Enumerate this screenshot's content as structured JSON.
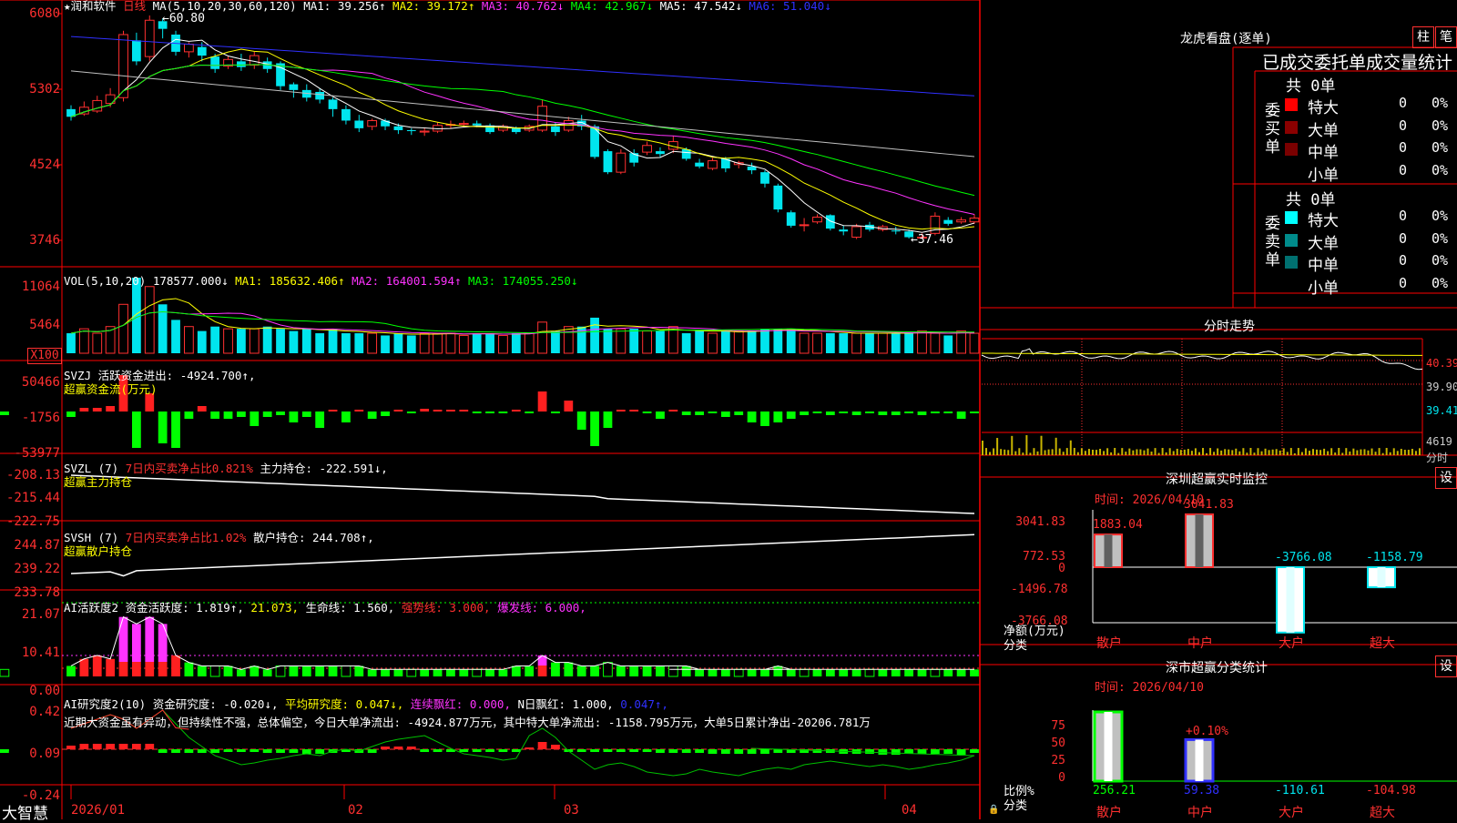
{
  "stock": {
    "star": "★",
    "name": "润和软件",
    "period": "日线"
  },
  "colors": {
    "up": "#ff3030",
    "down": "#00e5ee",
    "ma1": "#ffffff",
    "ma2": "#ffff00",
    "ma3": "#ff33ff",
    "ma4": "#00ff00",
    "ma5": "#c0c0c0",
    "ma6": "#3030ff",
    "frame": "#ff0000"
  },
  "main": {
    "ma_label": "MA(5,10,20,30,60,120)",
    "ma": [
      {
        "label": "MA1: 39.256",
        "arrow": "↑",
        "color": "#ffffff"
      },
      {
        "label": "MA2: 39.172",
        "arrow": "↑",
        "color": "#ffff00"
      },
      {
        "label": "MA3: 40.762",
        "arrow": "↓",
        "color": "#ff33ff"
      },
      {
        "label": "MA4: 42.967",
        "arrow": "↓",
        "color": "#00ff00"
      },
      {
        "label": "MA5: 47.542",
        "arrow": "↓",
        "color": "#ffffff"
      },
      {
        "label": "MA6: 51.040",
        "arrow": "↓",
        "color": "#3030ff"
      }
    ],
    "yticks": [
      "6080",
      "5302",
      "4524",
      "3746"
    ],
    "high_label": "60.80",
    "low_label": "37.46"
  },
  "vol": {
    "label": "VOL(5,10,20)",
    "items": [
      {
        "label": "178577.000",
        "arrow": "↓",
        "color": "#ffffff"
      },
      {
        "label": "MA1: 185632.406",
        "arrow": "↑",
        "color": "#ffff00"
      },
      {
        "label": "MA2: 164001.594",
        "arrow": "↑",
        "color": "#ff33ff"
      },
      {
        "label": "MA3: 174055.250",
        "arrow": "↓",
        "color": "#00ff00"
      }
    ],
    "yticks": [
      "11064",
      "5464"
    ],
    "unit": "X100"
  },
  "svzj": {
    "title": "SVZJ",
    "line1": "活跃资金进出: -4924.700↑,",
    "line2": "超赢资金流(万元)",
    "yticks": [
      "50466",
      "-1756",
      "-53977"
    ]
  },
  "svzl": {
    "title": "SVZL (7)",
    "red": "7日内买卖净占比0.821%",
    "white": "主力持仓: -222.591↓,",
    "line2": "超赢主力持仓",
    "yticks": [
      "-208.13",
      "-215.44",
      "-222.75"
    ]
  },
  "svsh": {
    "title": "SVSH (7)",
    "red": "7日内买卖净占比1.02%",
    "white": "散户持仓: 244.708↑,",
    "line2": "超赢散户持仓",
    "yticks": [
      "244.87",
      "239.22",
      "233.78"
    ]
  },
  "ai1": {
    "title": "AI活跃度2",
    "items": [
      {
        "label": "资金活跃度: 1.819↑,",
        "color": "#ffffff"
      },
      {
        "label": "21.073,",
        "color": "#ffff00"
      },
      {
        "label": "生命线: 1.560,",
        "color": "#ffffff"
      },
      {
        "label": "强势线: 3.000,",
        "color": "#ff3030"
      },
      {
        "label": "爆发线: 6.000,",
        "color": "#ff33ff"
      }
    ],
    "yticks": [
      "21.07",
      "10.41",
      "0.00"
    ]
  },
  "ai2": {
    "title": "AI研究度2(10)",
    "items": [
      {
        "label": "资金研究度: -0.020↓,",
        "color": "#ffffff"
      },
      {
        "label": "平均研究度: 0.047↓,",
        "color": "#ffff00"
      },
      {
        "label": "连续飘红: 0.000,",
        "color": "#ff33ff"
      },
      {
        "label": "N日飘红: 1.000,",
        "color": "#ffffff"
      },
      {
        "label": "0.047↑,",
        "color": "#3030ff"
      }
    ],
    "comment": "近期大资金虽有异动，但持续性不强，总体偏空，今日大单净流出: -4924.877万元，其中特大单净流出: -1158.795万元，大单5日累计净出-20206.781万",
    "yticks": [
      "0.42",
      "0.09",
      "-0.24"
    ]
  },
  "xaxis": {
    "labels": [
      "2026/01",
      "02",
      "03",
      "04"
    ],
    "brand": "大智慧"
  },
  "right": {
    "lhb": {
      "title": "龙虎看盘(逐单)",
      "btn1": "柱",
      "btn2": "笔",
      "header": "已成交委托单成交量统计",
      "buy": {
        "side_label": "委买单",
        "total": "共 0单",
        "rows": [
          {
            "name": "特大",
            "value": "0",
            "pct": "0%",
            "color": "#ff0000"
          },
          {
            "name": "大单",
            "value": "0",
            "pct": "0%",
            "color": "#8b0000"
          },
          {
            "name": "中单",
            "value": "0",
            "pct": "0%",
            "color": "#7a0000"
          },
          {
            "name": "小单",
            "value": "0",
            "pct": "0%",
            "color": ""
          }
        ]
      },
      "sell": {
        "side_label": "委卖单",
        "total": "共 0单",
        "rows": [
          {
            "name": "特大",
            "value": "0",
            "pct": "0%",
            "color": "#00ffff"
          },
          {
            "name": "大单",
            "value": "0",
            "pct": "0%",
            "color": "#008b8b"
          },
          {
            "name": "中单",
            "value": "0",
            "pct": "0%",
            "color": "#007070"
          },
          {
            "name": "小单",
            "value": "0",
            "pct": "0%",
            "color": ""
          }
        ]
      }
    },
    "fenshi": {
      "title": "分时走势",
      "prices": [
        "40.39",
        "39.90",
        "39.41"
      ],
      "vol_label": "4619",
      "vol_unit": "分时"
    },
    "monitor": {
      "title": "深圳超赢实时监控",
      "btn": "设",
      "time": "时间: 2026/04/10",
      "yticks": [
        "3041.83",
        "772.53",
        "0",
        "-1496.78",
        "-3766.08"
      ],
      "ylabel": "净额(万元)",
      "xlabel": "分类",
      "bars": [
        {
          "name": "散户",
          "value": 1883.04,
          "label": "1883.04"
        },
        {
          "name": "中户",
          "value": 3041.83,
          "label": "3041.83"
        },
        {
          "name": "大户",
          "value": -3766.08,
          "label": "-3766.08"
        },
        {
          "name": "超大",
          "value": -1158.79,
          "label": "-1158.79"
        }
      ]
    },
    "classify": {
      "title": "深市超赢分类统计",
      "btn": "设",
      "time": "时间: 2026/04/10",
      "yticks": [
        "75",
        "50",
        "25",
        "0"
      ],
      "ylabel": "比例%",
      "xlabel": "分类",
      "extra_label": "+0.10%",
      "bars": [
        {
          "name": "散户",
          "label": "256.21",
          "value": 100
        },
        {
          "name": "中户",
          "label": "59.38",
          "value": 60
        },
        {
          "name": "大户",
          "label": "-110.61",
          "value": 0
        },
        {
          "name": "超大",
          "label": "-104.98",
          "value": 0
        }
      ]
    }
  },
  "chart_data": {
    "type": "candlestick",
    "x_labels": [
      "2026/01",
      "02",
      "03",
      "04"
    ],
    "ylim": [
      37.46,
      60.8
    ],
    "candles": [
      {
        "o": 51.0,
        "c": 50.2,
        "h": 51.4,
        "l": 49.8
      },
      {
        "o": 50.5,
        "c": 51.2,
        "h": 51.8,
        "l": 50.3
      },
      {
        "o": 50.8,
        "c": 51.9,
        "h": 52.4,
        "l": 50.6
      },
      {
        "o": 51.6,
        "c": 52.5,
        "h": 53.2,
        "l": 51.2
      },
      {
        "o": 52.2,
        "c": 58.8,
        "h": 59.2,
        "l": 51.8
      },
      {
        "o": 58.2,
        "c": 56.0,
        "h": 59.0,
        "l": 55.6
      },
      {
        "o": 56.5,
        "c": 60.3,
        "h": 60.8,
        "l": 56.0
      },
      {
        "o": 60.2,
        "c": 59.4,
        "h": 60.5,
        "l": 58.4
      },
      {
        "o": 58.8,
        "c": 57.0,
        "h": 59.2,
        "l": 56.6
      },
      {
        "o": 57.0,
        "c": 57.8,
        "h": 58.0,
        "l": 56.4
      },
      {
        "o": 57.5,
        "c": 56.6,
        "h": 58.0,
        "l": 56.0
      },
      {
        "o": 56.5,
        "c": 55.2,
        "h": 56.8,
        "l": 54.8
      },
      {
        "o": 55.5,
        "c": 56.2,
        "h": 56.6,
        "l": 55.2
      },
      {
        "o": 56.0,
        "c": 55.4,
        "h": 56.8,
        "l": 55.0
      },
      {
        "o": 55.6,
        "c": 56.6,
        "h": 57.0,
        "l": 55.2
      },
      {
        "o": 56.0,
        "c": 55.2,
        "h": 56.4,
        "l": 54.8
      },
      {
        "o": 55.8,
        "c": 53.4,
        "h": 56.0,
        "l": 53.0
      },
      {
        "o": 53.6,
        "c": 53.0,
        "h": 53.8,
        "l": 52.2
      },
      {
        "o": 53.0,
        "c": 52.2,
        "h": 53.6,
        "l": 51.8
      },
      {
        "o": 52.8,
        "c": 52.0,
        "h": 53.2,
        "l": 51.6
      },
      {
        "o": 52.0,
        "c": 51.0,
        "h": 52.2,
        "l": 50.2
      },
      {
        "o": 51.0,
        "c": 49.8,
        "h": 51.4,
        "l": 49.4
      },
      {
        "o": 49.8,
        "c": 49.0,
        "h": 50.4,
        "l": 48.6
      },
      {
        "o": 49.2,
        "c": 49.8,
        "h": 50.0,
        "l": 48.8
      },
      {
        "o": 49.8,
        "c": 49.2,
        "h": 50.0,
        "l": 48.8
      },
      {
        "o": 49.2,
        "c": 48.8,
        "h": 49.5,
        "l": 48.4
      },
      {
        "o": 48.8,
        "c": 48.7,
        "h": 49.0,
        "l": 48.3
      },
      {
        "o": 48.6,
        "c": 48.7,
        "h": 49.0,
        "l": 48.2
      },
      {
        "o": 48.7,
        "c": 49.3,
        "h": 49.6,
        "l": 48.5
      },
      {
        "o": 49.3,
        "c": 49.4,
        "h": 49.8,
        "l": 49.0
      },
      {
        "o": 49.4,
        "c": 49.5,
        "h": 49.8,
        "l": 49.1
      },
      {
        "o": 49.5,
        "c": 49.3,
        "h": 49.8,
        "l": 49.1
      },
      {
        "o": 49.3,
        "c": 48.6,
        "h": 49.5,
        "l": 48.4
      },
      {
        "o": 48.8,
        "c": 49.2,
        "h": 49.4,
        "l": 48.6
      },
      {
        "o": 49.0,
        "c": 48.6,
        "h": 49.2,
        "l": 48.4
      },
      {
        "o": 48.8,
        "c": 49.2,
        "h": 49.4,
        "l": 48.6
      },
      {
        "o": 48.8,
        "c": 51.3,
        "h": 52.0,
        "l": 48.6
      },
      {
        "o": 49.2,
        "c": 48.6,
        "h": 49.6,
        "l": 48.2
      },
      {
        "o": 48.8,
        "c": 49.8,
        "h": 50.2,
        "l": 48.6
      },
      {
        "o": 49.8,
        "c": 49.2,
        "h": 50.4,
        "l": 48.8
      },
      {
        "o": 49.2,
        "c": 46.0,
        "h": 49.4,
        "l": 45.8
      },
      {
        "o": 46.6,
        "c": 44.4,
        "h": 46.8,
        "l": 44.2
      },
      {
        "o": 44.4,
        "c": 46.4,
        "h": 46.8,
        "l": 44.2
      },
      {
        "o": 46.4,
        "c": 45.4,
        "h": 46.8,
        "l": 45.0
      },
      {
        "o": 46.5,
        "c": 47.2,
        "h": 47.6,
        "l": 46.2
      },
      {
        "o": 46.6,
        "c": 46.3,
        "h": 47.0,
        "l": 46.0
      },
      {
        "o": 46.8,
        "c": 47.6,
        "h": 48.2,
        "l": 46.4
      },
      {
        "o": 46.8,
        "c": 45.8,
        "h": 47.0,
        "l": 45.6
      },
      {
        "o": 45.4,
        "c": 45.0,
        "h": 45.8,
        "l": 44.8
      },
      {
        "o": 44.8,
        "c": 45.6,
        "h": 45.9,
        "l": 44.6
      },
      {
        "o": 45.8,
        "c": 44.8,
        "h": 46.0,
        "l": 44.4
      },
      {
        "o": 45.2,
        "c": 45.4,
        "h": 45.6,
        "l": 44.8
      },
      {
        "o": 45.0,
        "c": 44.6,
        "h": 45.4,
        "l": 44.2
      },
      {
        "o": 44.4,
        "c": 43.2,
        "h": 44.6,
        "l": 42.8
      },
      {
        "o": 43.0,
        "c": 40.5,
        "h": 43.2,
        "l": 40.2
      },
      {
        "o": 40.2,
        "c": 38.8,
        "h": 40.4,
        "l": 38.6
      },
      {
        "o": 38.9,
        "c": 38.9,
        "h": 39.6,
        "l": 38.2
      },
      {
        "o": 39.2,
        "c": 39.7,
        "h": 40.0,
        "l": 39.0
      },
      {
        "o": 39.9,
        "c": 38.5,
        "h": 40.0,
        "l": 38.3
      },
      {
        "o": 38.4,
        "c": 38.2,
        "h": 38.8,
        "l": 37.8
      },
      {
        "o": 37.6,
        "c": 38.7,
        "h": 39.0,
        "l": 37.4
      },
      {
        "o": 38.9,
        "c": 38.4,
        "h": 39.2,
        "l": 38.2
      },
      {
        "o": 38.4,
        "c": 38.7,
        "h": 38.9,
        "l": 38.2
      },
      {
        "o": 38.3,
        "c": 38.2,
        "h": 38.7,
        "l": 37.9
      },
      {
        "o": 38.2,
        "c": 37.6,
        "h": 38.4,
        "l": 37.46
      },
      {
        "o": 37.6,
        "c": 37.6,
        "h": 38.0,
        "l": 37.5
      },
      {
        "o": 38.0,
        "c": 39.8,
        "h": 40.2,
        "l": 37.8
      },
      {
        "o": 39.4,
        "c": 39.0,
        "h": 39.7,
        "l": 38.8
      },
      {
        "o": 39.2,
        "c": 39.4,
        "h": 39.7,
        "l": 39.0
      },
      {
        "o": 39.2,
        "c": 39.6,
        "h": 40.0,
        "l": 39.0
      }
    ],
    "vol_ylim": [
      0,
      11064
    ],
    "svsh_ylim": [
      233.78,
      244.87
    ],
    "svzl_ylim": [
      -222.75,
      -208.13
    ],
    "ai1_ylim": [
      0,
      21.07
    ],
    "ai2_ylim": [
      -0.24,
      0.42
    ]
  }
}
